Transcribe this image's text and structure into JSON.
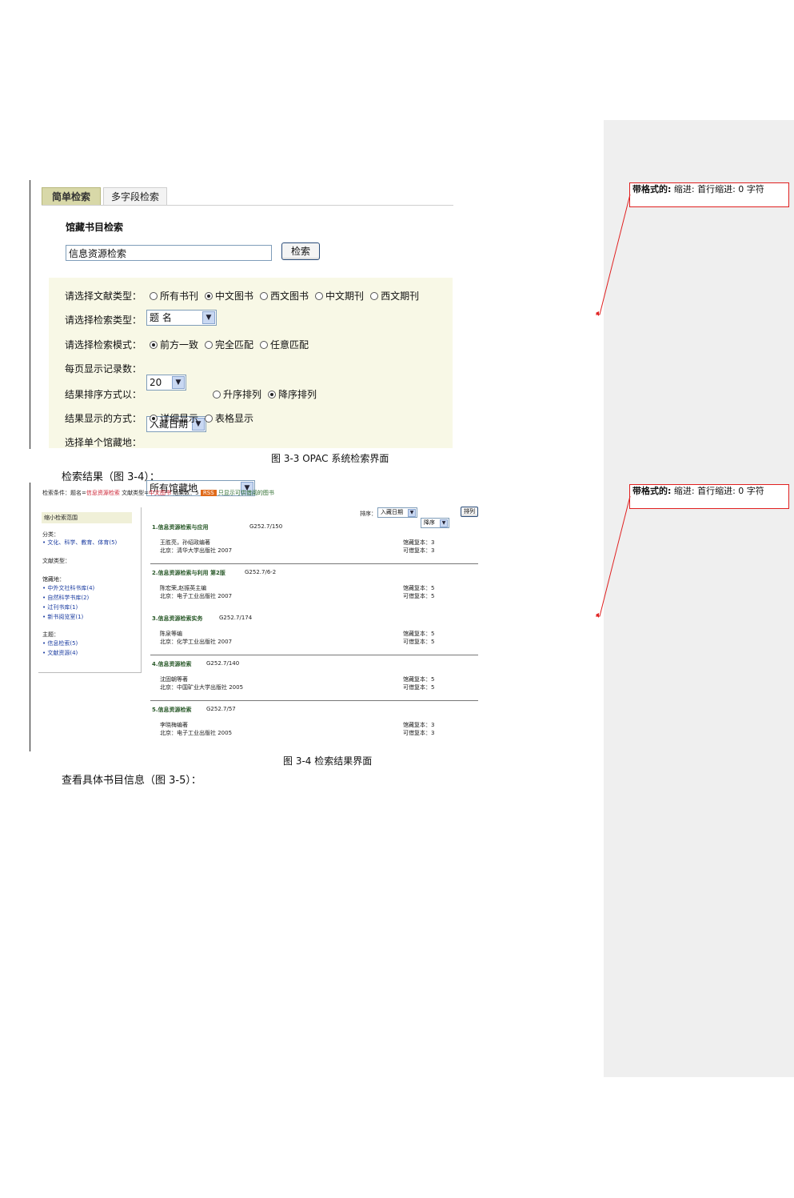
{
  "figure_3_3": {
    "tabs": [
      "简单检索",
      "多字段检索"
    ],
    "section_title": "馆藏书目检索",
    "search_value": "信息资源检索",
    "search_button": "检索",
    "doc_type": {
      "label": "请选择文献类型：",
      "options": [
        "所有书刊",
        "中文图书",
        "西文图书",
        "中文期刊",
        "西文期刊"
      ],
      "selected": 1
    },
    "search_type": {
      "label": "请选择检索类型：",
      "value": "题 名"
    },
    "search_mode": {
      "label": "请选择检索模式：",
      "options": [
        "前方一致",
        "完全匹配",
        "任意匹配"
      ],
      "selected": 0
    },
    "page_size": {
      "label": "每页显示记录数：",
      "value": "20"
    },
    "sort": {
      "label": "结果排序方式以：",
      "value": "入藏日期",
      "options": [
        "升序排列",
        "降序排列"
      ],
      "selected": 1
    },
    "display": {
      "label": "结果显示的方式：",
      "options": [
        "详细显示",
        "表格显示"
      ],
      "selected": 0
    },
    "location": {
      "label": "选择单个馆藏地：",
      "value": "所有馆藏地"
    },
    "caption": "图 3-3 OPAC 系统检索界面"
  },
  "para_results": "检索结果（图 3-4）：",
  "figure_3_4": {
    "top_line_parts": [
      "检索条件：题名=",
      "信息资源检索",
      "  文献类型=",
      "中文图书",
      "     结果数：5",
      "RSS",
      "只显示可供借阅的图书"
    ],
    "sort_label": "排序：",
    "sort_value": "入藏日期",
    "order_value": "降序",
    "sort_button": "排列",
    "sidebar": {
      "header": "缩小检索范围",
      "groups": [
        {
          "title": "分类：",
          "items": [
            "• 文化、科学、教育、体育(5)"
          ]
        },
        {
          "title": "文献类型：",
          "items": []
        },
        {
          "title": "馆藏地：",
          "items": [
            "• 中外文社科书库(4)",
            "• 自然科学书库(2)",
            "• 过刊书库(1)",
            "• 新书阅览室(1)"
          ]
        },
        {
          "title": "主题：",
          "items": [
            "• 信息检索(5)",
            "• 文献资源(4)"
          ]
        }
      ]
    },
    "results": [
      {
        "title": "1.信息资源检索与应用",
        "call": "G252.7/150",
        "line1": "王胜亮，孙绍政编著",
        "line2": "北京：清华大学出版社 2007",
        "held": "馆藏复本：3",
        "avail": "可借复本：3"
      },
      {
        "title": "2.信息资源检索与利用 第2版",
        "call": "G252.7/6-2",
        "line1": "陈宏荣,赵振英主编",
        "line2": "北京：电子工业出版社 2007",
        "held": "馆藏复本：5",
        "avail": "可借复本：5"
      },
      {
        "title": "3.信息资源检索实务",
        "call": "G252.7/174",
        "line1": "陈泉等编",
        "line2": "北京：化学工业出版社 2007",
        "held": "馆藏复本：5",
        "avail": "可借复本：5"
      },
      {
        "title": "4.信息资源检索",
        "call": "G252.7/140",
        "line1": "沈固朝等著",
        "line2": "北京：中国矿业大学出版社 2005",
        "held": "馆藏复本：5",
        "avail": "可借复本：5"
      },
      {
        "title": "5.信息资源检索",
        "call": "G252.7/57",
        "line1": "李晓梅编著",
        "line2": "北京：电子工业出版社 2005",
        "held": "馆藏复本：3",
        "avail": "可借复本：3"
      }
    ],
    "caption": "图 3-4 检索结果界面"
  },
  "para_details": "查看具体书目信息（图 3-5）：",
  "comments": [
    {
      "label": "带格式的:",
      "text": "缩进: 首行缩进:  0 字符"
    },
    {
      "label": "带格式的:",
      "text": "缩进: 首行缩进:  0 字符"
    }
  ],
  "colors": {
    "comment_border": "#e02020",
    "margin_pane": "#efefef",
    "tab_active": "#d8d8a8",
    "option_panel": "#f8f8e6"
  }
}
